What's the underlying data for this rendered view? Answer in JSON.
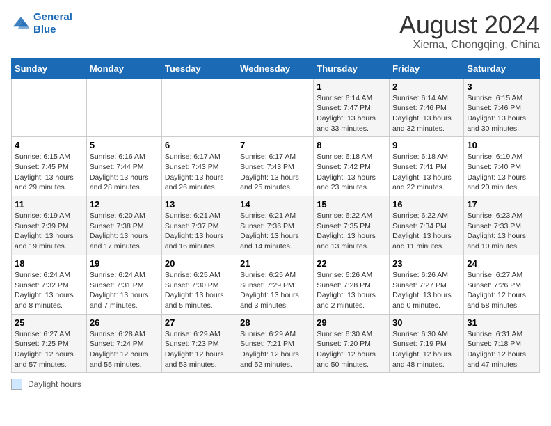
{
  "logo": {
    "line1": "General",
    "line2": "Blue"
  },
  "title": "August 2024",
  "subtitle": "Xiema, Chongqing, China",
  "days_header": [
    "Sunday",
    "Monday",
    "Tuesday",
    "Wednesday",
    "Thursday",
    "Friday",
    "Saturday"
  ],
  "weeks": [
    [
      {
        "day": "",
        "info": ""
      },
      {
        "day": "",
        "info": ""
      },
      {
        "day": "",
        "info": ""
      },
      {
        "day": "",
        "info": ""
      },
      {
        "day": "1",
        "info": "Sunrise: 6:14 AM\nSunset: 7:47 PM\nDaylight: 13 hours\nand 33 minutes."
      },
      {
        "day": "2",
        "info": "Sunrise: 6:14 AM\nSunset: 7:46 PM\nDaylight: 13 hours\nand 32 minutes."
      },
      {
        "day": "3",
        "info": "Sunrise: 6:15 AM\nSunset: 7:46 PM\nDaylight: 13 hours\nand 30 minutes."
      }
    ],
    [
      {
        "day": "4",
        "info": "Sunrise: 6:15 AM\nSunset: 7:45 PM\nDaylight: 13 hours\nand 29 minutes."
      },
      {
        "day": "5",
        "info": "Sunrise: 6:16 AM\nSunset: 7:44 PM\nDaylight: 13 hours\nand 28 minutes."
      },
      {
        "day": "6",
        "info": "Sunrise: 6:17 AM\nSunset: 7:43 PM\nDaylight: 13 hours\nand 26 minutes."
      },
      {
        "day": "7",
        "info": "Sunrise: 6:17 AM\nSunset: 7:43 PM\nDaylight: 13 hours\nand 25 minutes."
      },
      {
        "day": "8",
        "info": "Sunrise: 6:18 AM\nSunset: 7:42 PM\nDaylight: 13 hours\nand 23 minutes."
      },
      {
        "day": "9",
        "info": "Sunrise: 6:18 AM\nSunset: 7:41 PM\nDaylight: 13 hours\nand 22 minutes."
      },
      {
        "day": "10",
        "info": "Sunrise: 6:19 AM\nSunset: 7:40 PM\nDaylight: 13 hours\nand 20 minutes."
      }
    ],
    [
      {
        "day": "11",
        "info": "Sunrise: 6:19 AM\nSunset: 7:39 PM\nDaylight: 13 hours\nand 19 minutes."
      },
      {
        "day": "12",
        "info": "Sunrise: 6:20 AM\nSunset: 7:38 PM\nDaylight: 13 hours\nand 17 minutes."
      },
      {
        "day": "13",
        "info": "Sunrise: 6:21 AM\nSunset: 7:37 PM\nDaylight: 13 hours\nand 16 minutes."
      },
      {
        "day": "14",
        "info": "Sunrise: 6:21 AM\nSunset: 7:36 PM\nDaylight: 13 hours\nand 14 minutes."
      },
      {
        "day": "15",
        "info": "Sunrise: 6:22 AM\nSunset: 7:35 PM\nDaylight: 13 hours\nand 13 minutes."
      },
      {
        "day": "16",
        "info": "Sunrise: 6:22 AM\nSunset: 7:34 PM\nDaylight: 13 hours\nand 11 minutes."
      },
      {
        "day": "17",
        "info": "Sunrise: 6:23 AM\nSunset: 7:33 PM\nDaylight: 13 hours\nand 10 minutes."
      }
    ],
    [
      {
        "day": "18",
        "info": "Sunrise: 6:24 AM\nSunset: 7:32 PM\nDaylight: 13 hours\nand 8 minutes."
      },
      {
        "day": "19",
        "info": "Sunrise: 6:24 AM\nSunset: 7:31 PM\nDaylight: 13 hours\nand 7 minutes."
      },
      {
        "day": "20",
        "info": "Sunrise: 6:25 AM\nSunset: 7:30 PM\nDaylight: 13 hours\nand 5 minutes."
      },
      {
        "day": "21",
        "info": "Sunrise: 6:25 AM\nSunset: 7:29 PM\nDaylight: 13 hours\nand 3 minutes."
      },
      {
        "day": "22",
        "info": "Sunrise: 6:26 AM\nSunset: 7:28 PM\nDaylight: 13 hours\nand 2 minutes."
      },
      {
        "day": "23",
        "info": "Sunrise: 6:26 AM\nSunset: 7:27 PM\nDaylight: 13 hours\nand 0 minutes."
      },
      {
        "day": "24",
        "info": "Sunrise: 6:27 AM\nSunset: 7:26 PM\nDaylight: 12 hours\nand 58 minutes."
      }
    ],
    [
      {
        "day": "25",
        "info": "Sunrise: 6:27 AM\nSunset: 7:25 PM\nDaylight: 12 hours\nand 57 minutes."
      },
      {
        "day": "26",
        "info": "Sunrise: 6:28 AM\nSunset: 7:24 PM\nDaylight: 12 hours\nand 55 minutes."
      },
      {
        "day": "27",
        "info": "Sunrise: 6:29 AM\nSunset: 7:23 PM\nDaylight: 12 hours\nand 53 minutes."
      },
      {
        "day": "28",
        "info": "Sunrise: 6:29 AM\nSunset: 7:21 PM\nDaylight: 12 hours\nand 52 minutes."
      },
      {
        "day": "29",
        "info": "Sunrise: 6:30 AM\nSunset: 7:20 PM\nDaylight: 12 hours\nand 50 minutes."
      },
      {
        "day": "30",
        "info": "Sunrise: 6:30 AM\nSunset: 7:19 PM\nDaylight: 12 hours\nand 48 minutes."
      },
      {
        "day": "31",
        "info": "Sunrise: 6:31 AM\nSunset: 7:18 PM\nDaylight: 12 hours\nand 47 minutes."
      }
    ]
  ],
  "footer": {
    "legend_label": "Daylight hours"
  }
}
